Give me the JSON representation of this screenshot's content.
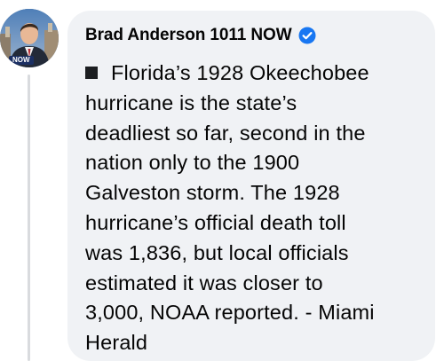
{
  "author": {
    "name": "Brad Anderson 1011 NOW",
    "verified_icon": "verified-badge-icon",
    "verified_color": "#1877f2",
    "avatar_badge": "NOW"
  },
  "post": {
    "bullet_icon": "black-square-icon",
    "lines": [
      "Florida’s 1928 Okeechobee",
      "hurricane is the state’s",
      "deadliest so far, second in the",
      "nation only to the 1900",
      "Galveston storm. The 1928",
      "hurricane’s official death toll",
      "was 1,836, but local officials",
      "estimated it was closer to",
      "3,000, NOAA reported. - Miami",
      "Herald"
    ]
  },
  "colors": {
    "bubble_background": "#f0f2f5",
    "text": "#050505",
    "thread_line": "#d9dbde"
  }
}
